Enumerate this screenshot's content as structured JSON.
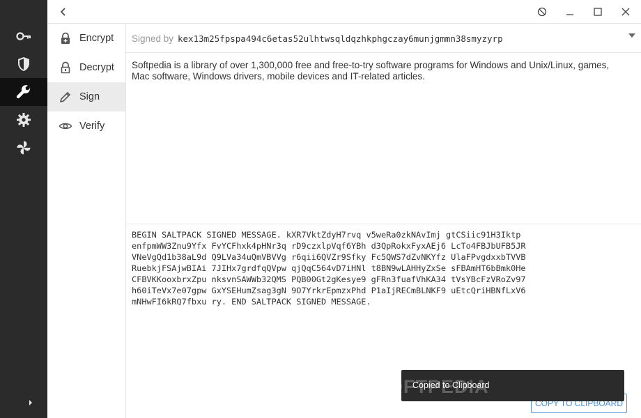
{
  "sidebar": {
    "items": [
      {
        "icon": "key-icon"
      },
      {
        "icon": "shield-icon"
      },
      {
        "icon": "wrench-icon",
        "active": true
      },
      {
        "icon": "gear-icon"
      },
      {
        "icon": "pinwheel-icon"
      }
    ]
  },
  "subnav": {
    "items": [
      {
        "label": "Encrypt",
        "icon": "lock-plus-icon"
      },
      {
        "label": "Decrypt",
        "icon": "unlock-icon"
      },
      {
        "label": "Sign",
        "icon": "pencil-icon",
        "active": true
      },
      {
        "label": "Verify",
        "icon": "eye-icon"
      }
    ]
  },
  "signed": {
    "label": "Signed by",
    "key": "kex13m25fpspa494c6etas52ulhtwsqldqzhkphgczay6munjgmmn38smyzyrp"
  },
  "input": {
    "text": "Softpedia is a library of over 1,300,000 free and free-to-try software programs for Windows and Unix/Linux, games, Mac software, Windows drivers, mobile devices and IT-related articles."
  },
  "output": {
    "text": "BEGIN SALTPACK SIGNED MESSAGE. kXR7VktZdyH7rvq v5weRa0zkNAvImj gtCSiic91H3Iktp\nenfpmWW3Znu9Yfx FvYCFhxk4pHNr3q rD9czxlpVqf6YBh d3QpRokxFyxAEj6 LcTo4FBJbUFB5JR\nVNeVgQd1b38aL9d Q9LVa34uQmVBVVg r6qii6QVZr9Sfky Fc5QWS7dZvNKYfz UlaFPvgdxxbTVVB\nRuebkjFSAjwBIAi 7JIHx7grdfqQVpw qjQqC564vD7iHNl t8BN9wLAHHyZxSe sFBAmHT6bBmk0He\nCFBVKKooxbrxZpu nksvnSAWWb32QMS PQB00Gt2gKesye9 gFRn3fuafVhKA34 tVsYBcFzVRoZv97\nh60iTeVx7e07gpw GxYSEHumZsag3gN 9O7YrkrEpmzxPhd P1aIjRECmBLNKF9 uEtcQriHBNfLxV6\nmNHwFI6kRQ7fbxu ry. END SALTPACK SIGNED MESSAGE."
  },
  "copy_button": {
    "label": "COPY TO CLIPBOARD"
  },
  "toast": {
    "text": "Copied to Clipboard"
  },
  "watermark": {
    "text": "SOFTPEDIA"
  },
  "colors": {
    "rail": "#2b2b2b",
    "rail_active": "#111111",
    "accent": "#4a90d9",
    "toast": "#2b2b2b"
  }
}
